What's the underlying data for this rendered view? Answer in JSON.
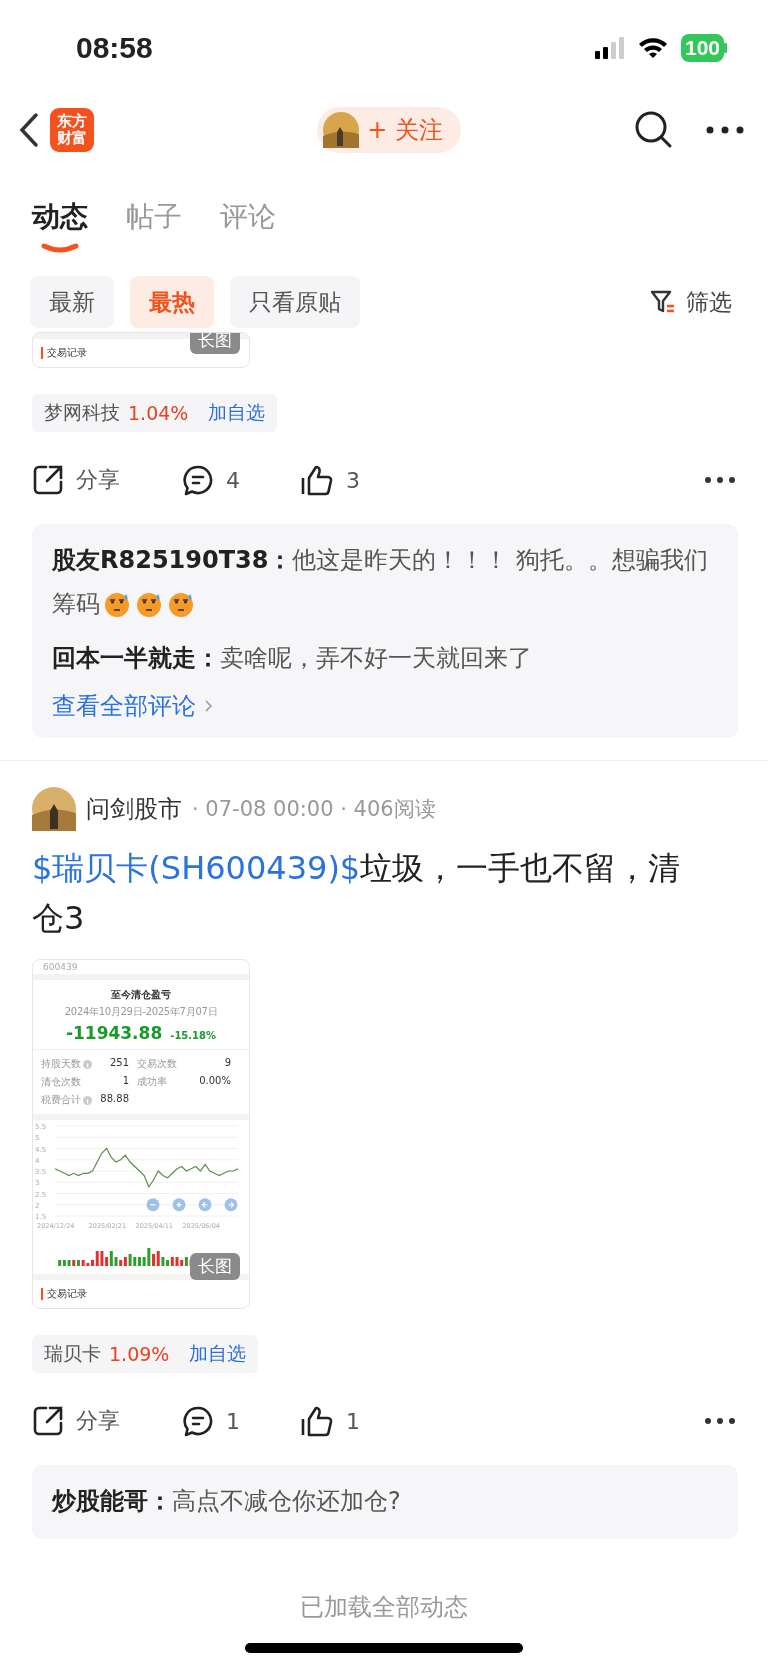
{
  "status_bar": {
    "time": "08:58",
    "battery": "100"
  },
  "nav": {
    "logo_lines": [
      "东方",
      "财富"
    ],
    "follow": "+ 关注"
  },
  "tabs": [
    {
      "label": "动态",
      "selected": true
    },
    {
      "label": "帖子",
      "selected": false
    },
    {
      "label": "评论",
      "selected": false
    }
  ],
  "filters": [
    {
      "label": "最新",
      "selected": false
    },
    {
      "label": "最热",
      "selected": true
    },
    {
      "label": "只看原贴",
      "selected": false
    }
  ],
  "filter_button": "筛选",
  "posts": [
    {
      "kind": "partial",
      "image": {
        "badge": "长图",
        "caption": "交易记录"
      },
      "stock": {
        "name": "梦网科技",
        "change": "1.04%",
        "action": "加自选"
      },
      "actions": {
        "share": "分享",
        "comments": "4",
        "likes": "3"
      },
      "comments": [
        {
          "user": "股友R825190T38：",
          "text": "他这是昨天的！！！ 狗托。。想骗我们筹码",
          "emojis": [
            {
              "kind": "sweat"
            },
            {
              "kind": "sweat"
            },
            {
              "kind": "sweat"
            }
          ]
        },
        {
          "user": "回本一半就走：",
          "text": "卖啥呢，弄不好一天就回来了"
        }
      ],
      "more_link": "查看全部评论"
    },
    {
      "kind": "full",
      "author": "问剑股市",
      "meta": "· 07-08 00:00 · 406阅读",
      "title_link": "$瑞贝卡(SH600439)$",
      "title_rest": "垃圾，一手也不留，清仓3",
      "image": {
        "code": "600439",
        "heading": "至今清仓盈亏",
        "period": "2024年10月29日-2025年7月07日",
        "pnl": "-11943.88",
        "pnl_pct": "-15.18%",
        "stats": [
          {
            "label": "持股天数",
            "value": "251",
            "info": true
          },
          {
            "label": "交易次数",
            "value": "9",
            "info": false
          },
          {
            "label": "清仓次数",
            "value": "1",
            "info": false
          },
          {
            "label": "成功率",
            "value": "0.00%",
            "info": false
          },
          {
            "label": "税费合计",
            "value": "88.88",
            "info": true
          }
        ],
        "chart_data": {
          "type": "line",
          "categories": [
            "2024/12/24",
            null,
            null,
            null,
            null,
            null,
            null,
            null,
            null,
            null,
            null,
            "2025/02/21",
            null,
            null,
            null,
            null,
            null,
            null,
            null,
            null,
            null,
            "2025/04/11",
            null,
            null,
            null,
            null,
            null,
            null,
            null,
            null,
            null,
            "2025/06/04",
            null,
            null,
            null,
            null,
            null,
            null,
            null,
            null
          ],
          "series": [
            {
              "color": "#5b8f4a",
              "values": [
                3.6,
                3.5,
                3.4,
                3.3,
                3.4,
                3.3,
                3.4,
                3.4,
                3.5,
                3.9,
                4.3,
                4.5,
                4.1,
                3.9,
                4.0,
                4.2,
                3.9,
                3.7,
                3.5,
                3.3,
                2.8,
                3.1,
                3.5,
                3.3,
                3.2,
                3.4,
                3.6,
                3.7,
                3.5,
                3.6,
                3.7,
                3.5,
                3.8,
                3.5,
                3.4,
                3.3,
                3.4,
                3.5,
                3.5,
                3.6
              ]
            }
          ],
          "grid": true,
          "ylim": [
            1.5,
            5.5
          ],
          "yticks": [
            1.5,
            2,
            2.5,
            3,
            3.5,
            4,
            4.5,
            5,
            5.5
          ]
        },
        "badge": "长图",
        "caption": "交易记录"
      },
      "stock": {
        "name": "瑞贝卡",
        "change": "1.09%",
        "action": "加自选"
      },
      "actions": {
        "share": "分享",
        "comments": "1",
        "likes": "1"
      },
      "comments": [
        {
          "user": "炒股能哥：",
          "text": "高点不减仓你还加仓?"
        }
      ]
    }
  ],
  "footer": "已加载全部动态"
}
